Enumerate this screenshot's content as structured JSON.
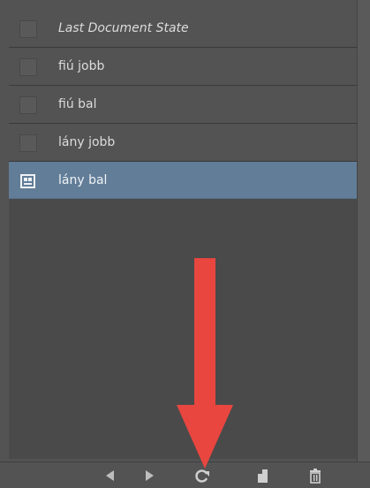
{
  "history_panel": {
    "states": [
      {
        "label": "Last Document State",
        "italic": true,
        "selected": false,
        "icon": "blank-thumbnail"
      },
      {
        "label": "fiú jobb",
        "italic": false,
        "selected": false,
        "icon": "blank-thumbnail"
      },
      {
        "label": "fiú bal",
        "italic": false,
        "selected": false,
        "icon": "blank-thumbnail"
      },
      {
        "label": "lány jobb",
        "italic": false,
        "selected": false,
        "icon": "blank-thumbnail"
      },
      {
        "label": "lány bal",
        "italic": false,
        "selected": true,
        "icon": "snapshot-icon"
      }
    ],
    "selected_color": "#627d97",
    "footer_buttons": [
      {
        "name": "previous-state-icon"
      },
      {
        "name": "next-state-icon"
      },
      {
        "name": "refresh-icon"
      },
      {
        "name": "new-document-icon"
      },
      {
        "name": "trash-icon"
      }
    ]
  },
  "annotation": {
    "arrow_color": "#e8463f",
    "target": "refresh-icon"
  }
}
